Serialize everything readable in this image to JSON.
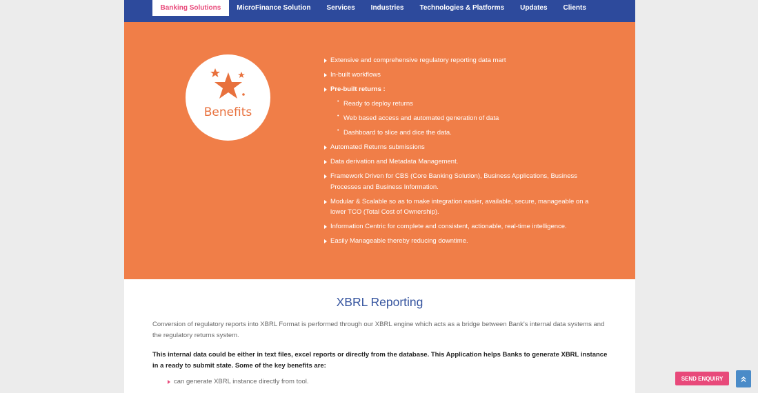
{
  "nav": {
    "items": [
      "Banking Solutions",
      "MicroFinance Solution",
      "Services",
      "Industries",
      "Technologies & Platforms",
      "Updates",
      "Clients"
    ],
    "active_index": 0
  },
  "benefits": {
    "badge_label": "Benefits",
    "badge_icon": "star-icon",
    "items": [
      "Extensive and comprehensive regulatory reporting data mart",
      "In-built workflows",
      "Pre-built returns :",
      "Automated Returns submissions",
      "Data derivation and Metadata Management.",
      "Framework Driven for CBS (Core Banking Solution), Business Applications, Business Processes and Business Information.",
      "Modular & Scalable so as to make integration easier, available, secure, manageable on a lower TCO (Total Cost of Ownership).",
      "Information Centric for complete and consistent, actionable, real-time intelligence.",
      "Easily Manageable thereby reducing downtime."
    ],
    "sub_items": [
      "Ready to deploy returns",
      "Web based access and automated generation of data",
      "Dashboard to slice and dice the data."
    ]
  },
  "xbrl": {
    "title": "XBRL Reporting",
    "para1": "Conversion of regulatory reports into XBRL Format is performed through our XBRL engine which acts as a bridge between Bank's internal data systems and the regulatory returns system.",
    "para2": "This internal data could be either in text files, excel reports or directly from the database. This Application helps Banks to generate XBRL instance in a ready to submit state. Some of the key benefits are:",
    "list": [
      "can generate XBRL instance directly from tool."
    ]
  },
  "actions": {
    "send_enquiry": "SEND ENQUIRY",
    "back_to_top_icon": "double-chevron-up-icon"
  },
  "colors": {
    "nav_bg": "#2d4a9c",
    "accent_pink": "#e8497a",
    "benefits_bg": "#f07e48",
    "title_blue": "#34539e",
    "top_button": "#4a8bc8"
  }
}
